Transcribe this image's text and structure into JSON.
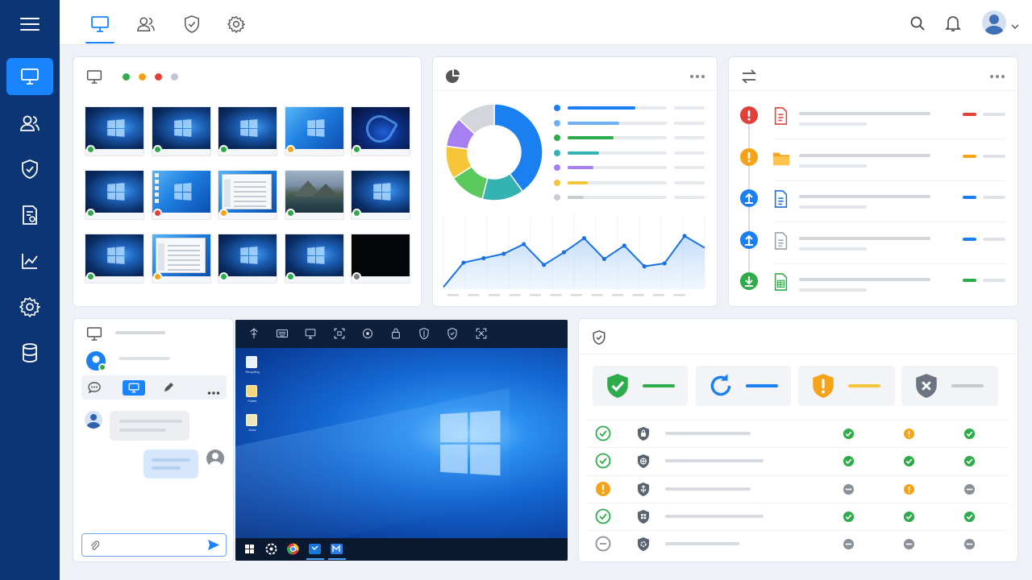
{
  "sidebar": {
    "menu_icon": "hamburger-menu-icon",
    "items": [
      {
        "icon": "monitor-icon",
        "active": true
      },
      {
        "icon": "users-icon",
        "active": false
      },
      {
        "icon": "shield-check-icon",
        "active": false
      },
      {
        "icon": "report-icon",
        "active": false
      },
      {
        "icon": "line-chart-icon",
        "active": false
      },
      {
        "icon": "gear-icon",
        "active": false
      },
      {
        "icon": "database-icon",
        "active": false
      }
    ]
  },
  "header": {
    "tabs": [
      {
        "icon": "monitor-icon",
        "active": true
      },
      {
        "icon": "users-icon",
        "active": false
      },
      {
        "icon": "shield-check-icon",
        "active": false
      },
      {
        "icon": "gear-icon",
        "active": false
      }
    ],
    "actions": [
      "search-icon",
      "bell-icon",
      "user-avatar-icon",
      "chevron-down-icon"
    ]
  },
  "colors": {
    "sidebar_bg": "#0b3574",
    "accent": "#1a84ff",
    "online": "#2eab4a",
    "warning": "#f5a31a",
    "error": "#e0413a",
    "offline": "#777777",
    "neutral": "#bfc6cf"
  },
  "monitor_panel": {
    "icon": "monitor-icon",
    "status_legend": [
      "online",
      "warning",
      "error",
      "neutral"
    ],
    "screens": [
      {
        "wallpaper": "windows-dark",
        "status": "online"
      },
      {
        "wallpaper": "windows-dark",
        "status": "online"
      },
      {
        "wallpaper": "windows-dark",
        "status": "online"
      },
      {
        "wallpaper": "windows-light",
        "status": "warning"
      },
      {
        "wallpaper": "windows-11-bloom",
        "status": "online"
      },
      {
        "wallpaper": "windows-dark",
        "status": "online"
      },
      {
        "wallpaper": "windows-light-desktop",
        "status": "error"
      },
      {
        "wallpaper": "file-explorer",
        "status": "warning"
      },
      {
        "wallpaper": "mountain-lake",
        "status": "online"
      },
      {
        "wallpaper": "windows-dark",
        "status": "online"
      },
      {
        "wallpaper": "windows-dark",
        "status": "online"
      },
      {
        "wallpaper": "windows-explorer-window",
        "status": "warning"
      },
      {
        "wallpaper": "windows-dark",
        "status": "online"
      },
      {
        "wallpaper": "windows-dark",
        "status": "online"
      },
      {
        "wallpaper": "black-screen",
        "status": "offline"
      }
    ]
  },
  "chart_panel": {
    "icon": "pie-chart-icon",
    "more_icon": "more-horizontal-icon"
  },
  "chart_data": [
    {
      "type": "pie",
      "slices": [
        {
          "value": 40,
          "color": "#1a7ff0"
        },
        {
          "value": 14,
          "color": "#35b3b3"
        },
        {
          "value": 12,
          "color": "#5cc95c"
        },
        {
          "value": 11,
          "color": "#f5c53a"
        },
        {
          "value": 10,
          "color": "#a67ff0"
        },
        {
          "value": 13,
          "color": "#d2d6db"
        }
      ],
      "legend_colors": [
        "#1a7ff0",
        "#6fb0f2",
        "#2eab4a",
        "#35b3b3",
        "#a67ff0",
        "#f5c53a",
        "#c8ccd2"
      ],
      "legend_fill": [
        0.68,
        0.52,
        0.46,
        0.32,
        0.26,
        0.2,
        0.16
      ]
    },
    {
      "type": "area",
      "values": [
        5,
        38,
        44,
        50,
        63,
        35,
        52,
        71,
        43,
        61,
        33,
        37,
        74,
        58
      ],
      "ylim": [
        0,
        100
      ],
      "color": "#1a72e0"
    }
  ],
  "transfer_panel": {
    "icon": "transfer-arrows-icon",
    "more_icon": "more-horizontal-icon",
    "items": [
      {
        "status_icon": "alert-icon",
        "status_color": "#e0413a",
        "file_icon": "pdf-file-icon",
        "file_color": "#e0413a",
        "tag_color": "#e0413a"
      },
      {
        "status_icon": "alert-icon",
        "status_color": "#f5a31a",
        "file_icon": "folder-icon",
        "file_color": "#f5a31a",
        "tag_color": "#f5a31a"
      },
      {
        "status_icon": "upload-icon",
        "status_color": "#1a7ff0",
        "file_icon": "document-icon",
        "file_color": "#1a6fd6",
        "tag_color": "#1a7ff0"
      },
      {
        "status_icon": "upload-icon",
        "status_color": "#1a7ff0",
        "file_icon": "document-icon",
        "file_color": "#9aa2ad",
        "tag_color": "#1a7ff0"
      },
      {
        "status_icon": "download-icon",
        "status_color": "#2eab4a",
        "file_icon": "spreadsheet-icon",
        "file_color": "#2eab4a",
        "tag_color": "#2eab4a"
      }
    ]
  },
  "chat_panel": {
    "icon": "monitor-icon",
    "avatar_status": "online",
    "tabs": [
      {
        "icon": "chat-bubble-icon",
        "active": false
      },
      {
        "icon": "monitor-icon",
        "active": true
      },
      {
        "icon": "pen-icon",
        "active": false
      },
      {
        "icon": "more-horizontal-icon",
        "active": false
      }
    ],
    "input_placeholder": "",
    "attach_icon": "paperclip-icon",
    "send_icon": "send-icon"
  },
  "remote_desktop": {
    "toolbar": [
      "connection-icon",
      "keyboard-icon",
      "monitor-icon",
      "screenshot-icon",
      "record-icon",
      "lock-icon",
      "shield-icon",
      "shield-check-icon",
      "fullscreen-icon"
    ],
    "desktop_icons": [
      {
        "icon": "recycle-bin-icon",
        "label": "Recycling"
      },
      {
        "icon": "folder-icon",
        "label": "Folder"
      },
      {
        "icon": "document-icon",
        "label": "Docs"
      }
    ],
    "taskbar": [
      "windows-start-icon",
      "settings-icon",
      "chrome-icon",
      "outlook-icon",
      "remote-app-icon"
    ]
  },
  "security_panel": {
    "icon": "shield-check-icon",
    "stats": [
      {
        "icon": "shield-check-icon",
        "color": "#2eab4a"
      },
      {
        "icon": "refresh-icon",
        "color": "#1a7ff0"
      },
      {
        "icon": "shield-alert-icon",
        "color": "#f5a31a"
      },
      {
        "icon": "shield-x-icon",
        "color": "#6b7480"
      }
    ],
    "rows": [
      {
        "status": "ok",
        "type_icon": "shield-lock-icon",
        "cells": [
          "ok",
          "warn",
          "ok"
        ]
      },
      {
        "status": "ok",
        "type_icon": "shield-globe-icon",
        "cells": [
          "ok",
          "ok",
          "ok"
        ]
      },
      {
        "status": "warn",
        "type_icon": "shield-usb-icon",
        "cells": [
          "off",
          "warn",
          "off"
        ]
      },
      {
        "status": "ok",
        "type_icon": "shield-apps-icon",
        "cells": [
          "ok",
          "ok",
          "ok"
        ]
      },
      {
        "status": "off",
        "type_icon": "shield-gear-icon",
        "cells": [
          "off",
          "off",
          "off"
        ]
      }
    ]
  }
}
